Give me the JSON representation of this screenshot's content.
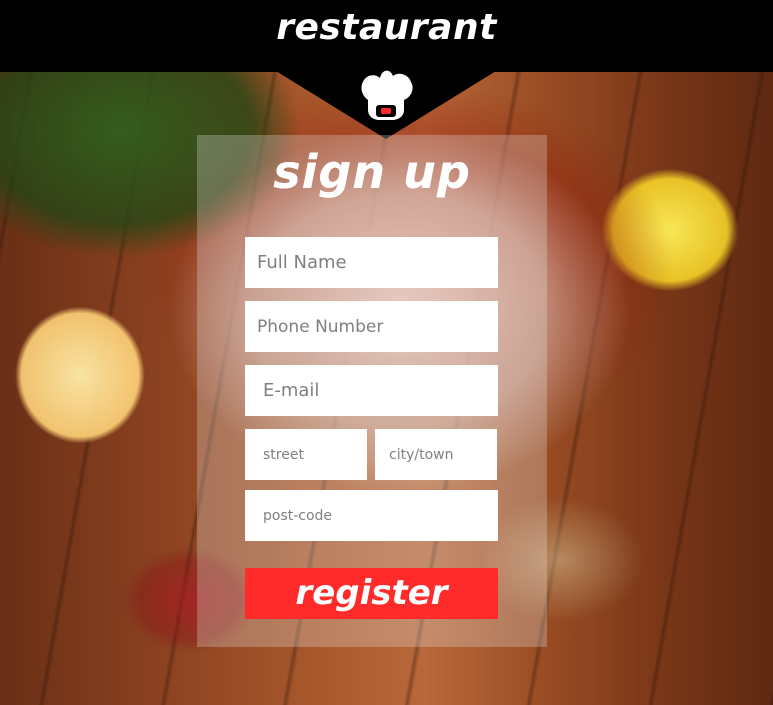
{
  "header": {
    "brand": "restaurant",
    "icon": "chef-hat-icon"
  },
  "signup": {
    "title": "sign up",
    "fields": {
      "full_name": {
        "placeholder": "Full Name",
        "value": ""
      },
      "phone": {
        "placeholder": "Phone Number",
        "value": ""
      },
      "email": {
        "placeholder": "E-mail",
        "value": ""
      },
      "street": {
        "placeholder": "street",
        "value": ""
      },
      "city": {
        "placeholder": "city/town",
        "value": ""
      },
      "post_code": {
        "placeholder": "post-code",
        "value": ""
      }
    },
    "register_label": "register"
  },
  "colors": {
    "header_bg": "#000000",
    "accent": "#ff2a2a",
    "card_overlay": "rgba(235,235,235,0.28)",
    "field_bg": "#ffffff"
  }
}
